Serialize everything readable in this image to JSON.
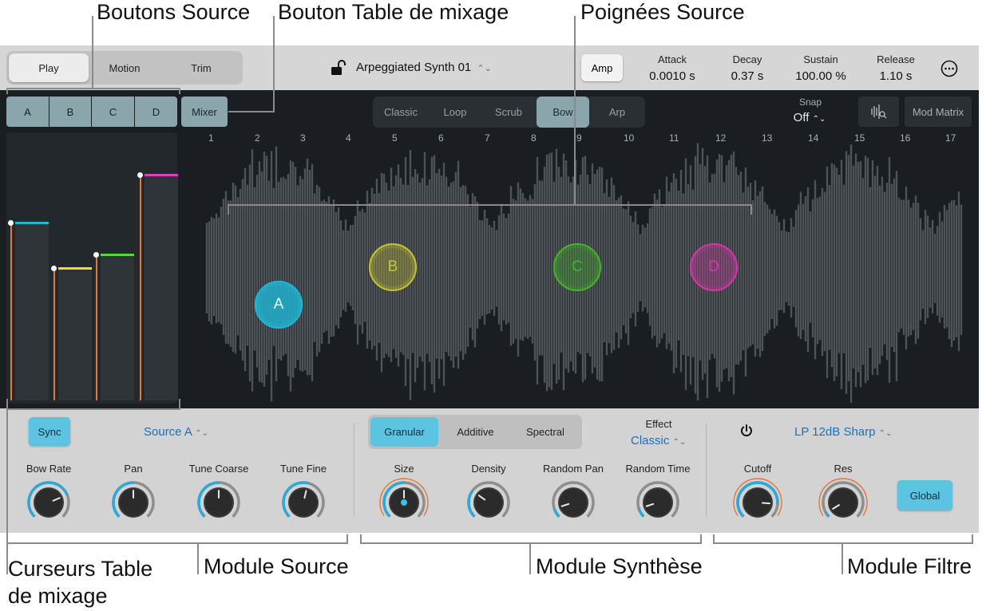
{
  "callouts": {
    "source_buttons": "Boutons Source",
    "mixer_button": "Bouton Table de mixage",
    "source_handles": "Poignées Source",
    "mixer_sliders_line1": "Curseurs Table",
    "mixer_sliders_line2": "de mixage",
    "source_module": "Module Source",
    "synthesis_module": "Module Synthèse",
    "filter_module": "Module Filtre"
  },
  "topbar": {
    "modes": [
      "Play",
      "Motion",
      "Trim"
    ],
    "selected_mode": "Play",
    "preset_name": "Arpeggiated Synth 01",
    "amp_label": "Amp",
    "envelope": [
      {
        "label": "Attack",
        "value": "0.0010 s"
      },
      {
        "label": "Decay",
        "value": "0.37 s"
      },
      {
        "label": "Sustain",
        "value": "100.00 %"
      },
      {
        "label": "Release",
        "value": "1.10 s"
      }
    ]
  },
  "sources": [
    "A",
    "B",
    "C",
    "D"
  ],
  "mixer_label": "Mixer",
  "play_modes": [
    "Classic",
    "Loop",
    "Scrub",
    "Bow",
    "Arp"
  ],
  "selected_play_mode": "Bow",
  "snap": {
    "label": "Snap",
    "value": "Off"
  },
  "mod_matrix_label": "Mod Matrix",
  "ruler": [
    "1",
    "2",
    "3",
    "4",
    "5",
    "6",
    "7",
    "8",
    "9",
    "10",
    "11",
    "12",
    "13",
    "14",
    "15",
    "16",
    "17"
  ],
  "mixer_levels": [
    0.68,
    0.51,
    0.56,
    0.86
  ],
  "handles": [
    {
      "label": "A",
      "color": "#1fb7d6"
    },
    {
      "label": "B",
      "color": "#c7c232"
    },
    {
      "label": "C",
      "color": "#46b52a"
    },
    {
      "label": "D",
      "color": "#d438a8"
    }
  ],
  "source_module": {
    "sync_label": "Sync",
    "source_select": "Source A",
    "knobs": [
      "Bow Rate",
      "Pan",
      "Tune Coarse",
      "Tune Fine"
    ]
  },
  "synthesis_module": {
    "types": [
      "Granular",
      "Additive",
      "Spectral"
    ],
    "selected_type": "Granular",
    "effect_label": "Effect",
    "effect_value": "Classic",
    "knobs": [
      "Size",
      "Density",
      "Random Pan",
      "Random Time"
    ]
  },
  "filter_module": {
    "filter_type": "LP 12dB Sharp",
    "knobs": [
      "Cutoff",
      "Res"
    ],
    "global_label": "Global"
  },
  "colors": {
    "accent": "#5cc3e0",
    "dark_bg": "#1a1e22",
    "waveform": "#4d5356"
  }
}
